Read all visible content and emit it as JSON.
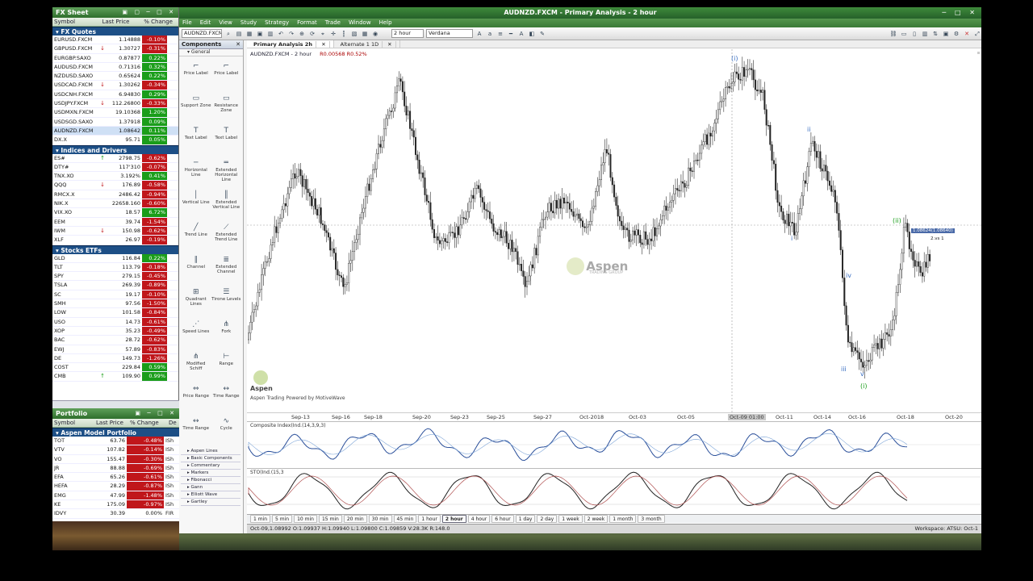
{
  "fx_sheet": {
    "title": "FX Sheet",
    "columns": [
      "Symbol",
      "Last Price",
      "% Change"
    ],
    "groups": [
      {
        "name": "FX Quotes",
        "rows": [
          [
            "EURUSD.FXCM",
            "",
            "1.14888",
            "-0.10%"
          ],
          [
            "GBPUSD.FXCM",
            "down",
            "1.30727",
            "-0.31%"
          ],
          [
            "EURGBP.SAXO",
            "",
            "0.87877",
            "0.22%"
          ],
          [
            "AUDUSD.FXCM",
            "",
            "0.71316",
            "0.32%"
          ],
          [
            "NZDUSD.SAXO",
            "",
            "0.65624",
            "0.22%"
          ],
          [
            "USDCAD.FXCM",
            "down",
            "1.30262",
            "-0.34%"
          ],
          [
            "USDCNH.FXCM",
            "",
            "6.94830",
            "0.29%"
          ],
          [
            "USDJPY.FXCM",
            "down",
            "112.26800",
            "-0.33%"
          ],
          [
            "USDMXN.FXCM",
            "",
            "19.10368",
            "1.20%"
          ],
          [
            "USDSGD.SAXO",
            "",
            "1.37918",
            "0.09%"
          ],
          [
            "AUDNZD.FXCM",
            "",
            "1.08642",
            "0.11%"
          ],
          [
            "DX.X",
            "",
            "95.71",
            "0.05%"
          ]
        ]
      },
      {
        "name": "Indices and Drivers",
        "rows": [
          [
            "ES#",
            "up",
            "2798.75",
            "-0.62%"
          ],
          [
            "DTY#",
            "",
            "117'310",
            "-0.07%"
          ],
          [
            "TNX.XO",
            "",
            "3.192%",
            "0.41%"
          ],
          [
            "QQQ",
            "down",
            "176.89",
            "-0.58%"
          ],
          [
            "RMCX.X",
            "",
            "2486.42",
            "-0.94%"
          ],
          [
            "NIK.X",
            "",
            "22658.160",
            "-0.60%"
          ],
          [
            "VIX.XO",
            "",
            "18.57",
            "6.72%"
          ],
          [
            "EEM",
            "",
            "39.74",
            "-1.54%"
          ],
          [
            "IWM",
            "down",
            "150.98",
            "-0.62%"
          ],
          [
            "XLF",
            "",
            "26.97",
            "-0.19%"
          ]
        ]
      },
      {
        "name": "Stocks ETFs",
        "rows": [
          [
            "GLD",
            "",
            "116.84",
            "0.22%"
          ],
          [
            "TLT",
            "",
            "113.79",
            "-0.18%"
          ],
          [
            "SPY",
            "",
            "279.15",
            "-0.45%"
          ],
          [
            "TSLA",
            "",
            "269.39",
            "-0.89%"
          ],
          [
            "SC",
            "",
            "19.17",
            "-0.10%"
          ],
          [
            "SMH",
            "",
            "97.56",
            "-1.50%"
          ],
          [
            "LOW",
            "",
            "101.58",
            "-0.84%"
          ],
          [
            "USO",
            "",
            "14.73",
            "-0.61%"
          ],
          [
            "XOP",
            "",
            "35.23",
            "-0.49%"
          ],
          [
            "BAC",
            "",
            "28.72",
            "-0.62%"
          ],
          [
            "EWJ",
            "",
            "57.89",
            "-0.83%"
          ],
          [
            "DE",
            "",
            "149.73",
            "-1.26%"
          ],
          [
            "COST",
            "",
            "229.84",
            "0.59%"
          ],
          [
            "CMB",
            "up",
            "109.90",
            "0.99%"
          ]
        ]
      }
    ]
  },
  "portfolio": {
    "title": "Portfolio",
    "columns": [
      "Symbol",
      "Last Price",
      "% Change",
      "De"
    ],
    "group": "Aspen Model Portfolio",
    "rows": [
      [
        "TOT",
        "63.76",
        "-0.48%",
        "ISh"
      ],
      [
        "VTV",
        "107.82",
        "-0.14%",
        "ISh"
      ],
      [
        "VO",
        "155.47",
        "-0.30%",
        "ISh"
      ],
      [
        "JR",
        "88.88",
        "-0.69%",
        "ISh"
      ],
      [
        "EFA",
        "65.26",
        "-0.61%",
        "ISh"
      ],
      [
        "HEFA",
        "28.29",
        "-0.87%",
        "ISh"
      ],
      [
        "EMG",
        "47.99",
        "-1.48%",
        "ISh"
      ],
      [
        "KE",
        "175.09",
        "-0.97%",
        "ISh"
      ],
      [
        "IDVY",
        "30.39",
        "0.00%",
        "FIR"
      ]
    ]
  },
  "app": {
    "title": "AUDNZD.FXCM - Primary Analysis - 2 hour",
    "menu": [
      "File",
      "Edit",
      "View",
      "Study",
      "Strategy",
      "Format",
      "Trade",
      "Window",
      "Help"
    ],
    "symbol_box": "AUDNZD.FXCM",
    "timeframe_box": "2 hour",
    "font_box": "Verdana",
    "tabs": [
      "Primary Analysis 2h",
      "Alternate 1 1D"
    ],
    "chart_header": "AUDNZD.FXCM - 2 hour",
    "chart_header_extra": "R0.00568 R0.52%",
    "components": {
      "title": "Components",
      "section": "General",
      "tools": [
        [
          "Price Label",
          "Price Label"
        ],
        [
          "Support Zone",
          "Resistance Zone"
        ],
        [
          "Text Label",
          "Text Label"
        ],
        [
          "Horizontal Line",
          "Extended Horizontal Line"
        ],
        [
          "Vertical Line",
          "Extended Vertical Line"
        ],
        [
          "Trend Line",
          "Extended Trend Line"
        ],
        [
          "Channel",
          "Extended Channel"
        ],
        [
          "Quadrant Lines",
          "Tirone Levels"
        ],
        [
          "Speed Lines",
          "Fork"
        ],
        [
          "Modified Schiff",
          "Range"
        ],
        [
          "Price Range",
          "Time Range"
        ],
        [
          "Time Range",
          "Cycle"
        ]
      ],
      "categories": [
        "Aspen Lines",
        "Basic Components",
        "Commentary",
        "Markers",
        "Fibonacci",
        "Gann",
        "Elliott Wave",
        "Gartley"
      ]
    },
    "x_axis": [
      "Sep-13",
      "Sep-16",
      "Sep-18",
      "Sep-20",
      "Sep-23",
      "Sep-25",
      "Sep-27",
      "Oct-2018",
      "Oct-03",
      "Oct-05",
      "Oct-09 01:00",
      "Oct-11",
      "Oct-14",
      "Oct-16",
      "Oct-18",
      "Oct-20"
    ],
    "indicator1_label": "Composite Index(Ind.(14,3,9,3)",
    "indicator2_label": "STO(Ind.(15,3",
    "price_tag": "1.08624(1.08640)",
    "price_tag2": "2.vs 1",
    "watermark": "Aspen",
    "watermark_sub": "TRADING GROUP",
    "bottom_brand": "Aspen",
    "bottom_caption": "Aspen Trading Powered by MotiveWave",
    "wave_labels": [
      "(i)",
      "i",
      "ii",
      "iii",
      "iv",
      "v",
      "(i)",
      "(ii)"
    ],
    "bar_sizes": [
      "1 min",
      "5 min",
      "10 min",
      "15 min",
      "20 min",
      "30 min",
      "45 min",
      "1 hour",
      "2 hour",
      "4 hour",
      "6 hour",
      "1 day",
      "2 day",
      "1 week",
      "2 week",
      "1 month",
      "3 month"
    ],
    "active_bar": "2 hour",
    "status": "Oct-09,1.08992 O:1.09937 H:1.09940 L:1.09800 C:1.09859 V:28.3K R:148.0",
    "workspace": "Workspace: ATSU: Oct-1"
  },
  "colors": {
    "up": "#1a9d1a",
    "down": "#c0161b",
    "group_header": "#1d4f86",
    "wave": "#3a6fc2"
  }
}
